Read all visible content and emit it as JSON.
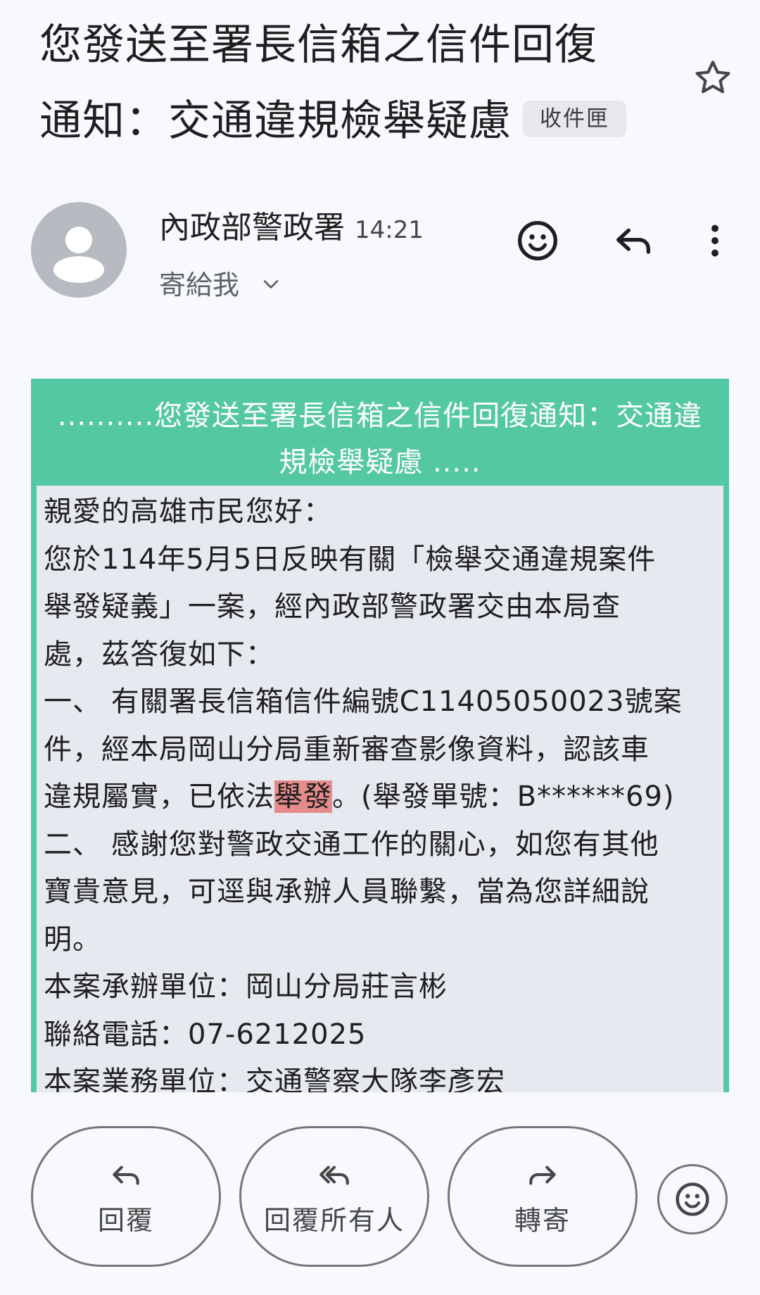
{
  "subject": {
    "line1": "您發送至署長信箱之信件回復",
    "line2": "通知：交通違規檢舉疑慮",
    "label_chip": "收件匣"
  },
  "sender": {
    "name": "內政部警政署",
    "time": "14:21",
    "recipient": "寄給我"
  },
  "body": {
    "header_line1": "..........您發送至署長信箱之信件回復通知：交通違",
    "header_line2": "規檢舉疑慮 .....",
    "lines": {
      "l1": "親愛的高雄市民您好：",
      "l2": "您於114年5月5日反映有關「檢舉交通違規案件",
      "l3": "舉發疑義」一案，經內政部警政署交由本局查",
      "l4": "處，茲答復如下：",
      "l5": "一、 有關署長信箱信件編號C11405050023號案",
      "l6": "件，經本局岡山分局重新審查影像資料，認該車",
      "l7_before": "違規屬實，已依法",
      "l7_highlight": "舉發",
      "l7_after": "。(舉發單號：B******69)",
      "l8": "二、 感謝您對警政交通工作的關心，如您有其他",
      "l9": "寶貴意見，可逕與承辦人員聯繫，當為您詳細說",
      "l10": "明。",
      "l11": "本案承辦單位：岡山分局莊言彬",
      "l12": "聯絡電話：07-6212025",
      "l13": "本案業務單位：交通警察大隊李彥宏"
    }
  },
  "actions": {
    "reply": "回覆",
    "reply_all": "回覆所有人",
    "forward": "轉寄"
  },
  "colors": {
    "card_accent": "#54c7a3",
    "highlight": "#e58b8b"
  }
}
